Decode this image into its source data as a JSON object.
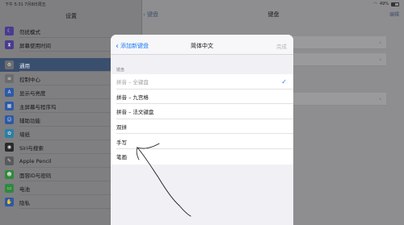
{
  "status": {
    "time_date": "下午 5:31  7月8日周五",
    "battery": "49%"
  },
  "sidebar": {
    "title": "设置",
    "items": [
      {
        "label": "勿扰模式",
        "icon": "moon-icon",
        "color": "#4a3b8f"
      },
      {
        "label": "屏幕使用时间",
        "icon": "hourglass-icon",
        "color": "#4a3b8f"
      },
      {
        "label": "通用",
        "icon": "gear-icon",
        "color": "#6c6c70",
        "selected": true
      },
      {
        "label": "控制中心",
        "icon": "switches-icon",
        "color": "#6c6c70"
      },
      {
        "label": "显示与亮度",
        "icon": "aa-icon",
        "color": "#2b5aa8"
      },
      {
        "label": "主屏幕与程序坞",
        "icon": "grid-icon",
        "color": "#2b5aa8"
      },
      {
        "label": "辅助功能",
        "icon": "accessibility-icon",
        "color": "#2b5aa8"
      },
      {
        "label": "墙纸",
        "icon": "flower-icon",
        "color": "#2d7fa6"
      },
      {
        "label": "Siri与搜索",
        "icon": "siri-icon",
        "color": "#2a2a2a"
      },
      {
        "label": "Apple Pencil",
        "icon": "pencil-icon",
        "color": "#5a5a5c"
      },
      {
        "label": "面容ID与密码",
        "icon": "faceid-icon",
        "color": "#2f8a3c"
      },
      {
        "label": "电池",
        "icon": "battery-icon",
        "color": "#2f8a3c"
      },
      {
        "label": "隐私",
        "icon": "hand-icon",
        "color": "#2b5aa8"
      }
    ]
  },
  "detail": {
    "back_label": "键盘",
    "title": "键盘",
    "edit_label": "编辑"
  },
  "modal": {
    "back_label": "添加新键盘",
    "title": "简体中文",
    "done_label": "完成",
    "section_label": "键盘",
    "keyboards": [
      {
        "label": "拼音 – 全键盘",
        "disabled": true,
        "checked": true
      },
      {
        "label": "拼音 – 九宫格",
        "disabled": false,
        "checked": false
      },
      {
        "label": "拼音 – 法文键盘",
        "disabled": false,
        "checked": false
      },
      {
        "label": "双拼",
        "disabled": false,
        "checked": false
      },
      {
        "label": "手写",
        "disabled": false,
        "checked": false
      },
      {
        "label": "笔画",
        "disabled": false,
        "checked": false
      }
    ]
  },
  "colors": {
    "accent": "#1a7cf5",
    "selected_row": "#3a4f6e"
  }
}
